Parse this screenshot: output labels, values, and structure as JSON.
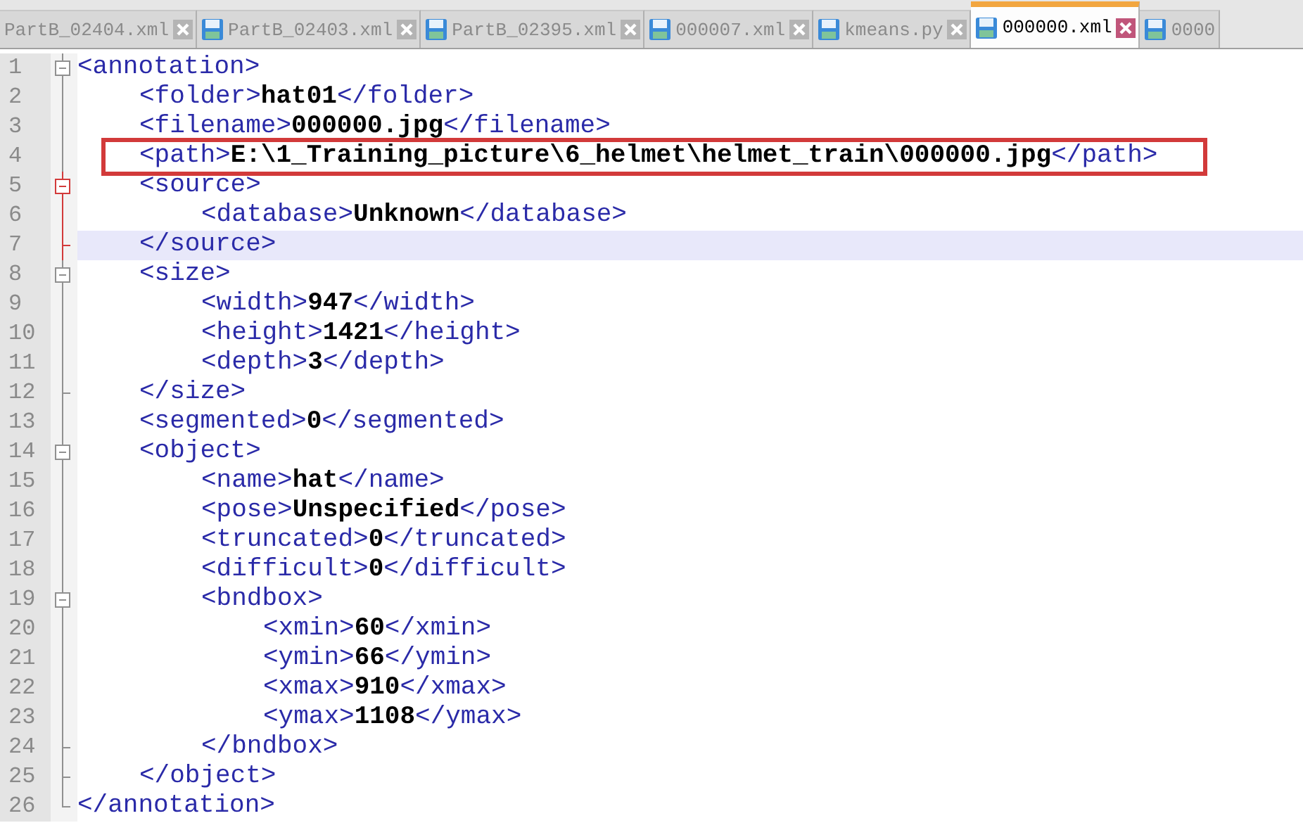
{
  "tabs": [
    {
      "label": "PartB_02404.xml",
      "icon": false,
      "closable": true,
      "selected": false
    },
    {
      "label": "PartB_02403.xml",
      "icon": true,
      "closable": true,
      "selected": false
    },
    {
      "label": "PartB_02395.xml",
      "icon": true,
      "closable": true,
      "selected": false
    },
    {
      "label": "000007.xml",
      "icon": true,
      "closable": true,
      "selected": false
    },
    {
      "label": "kmeans.py",
      "icon": true,
      "closable": true,
      "selected": false
    },
    {
      "label": "000000.xml",
      "icon": true,
      "closable": true,
      "selected": true
    },
    {
      "label": "0000",
      "icon": true,
      "closable": false,
      "selected": false
    }
  ],
  "document": [
    {
      "number": "1",
      "open": "<annotation>",
      "fold_highlighted": false,
      "current": false,
      "boxed": false,
      "children": [
        {
          "number": "2",
          "open": "<folder>",
          "value": "hat01",
          "close": "</folder>",
          "fold_highlighted": false,
          "current": false,
          "boxed": false
        },
        {
          "number": "3",
          "open": "<filename>",
          "value": "000000.jpg",
          "close": "</filename>",
          "fold_highlighted": false,
          "current": false,
          "boxed": false
        },
        {
          "number": "4",
          "open": "<path>",
          "value": "E:\\1_Training_picture\\6_helmet\\helmet_train\\000000.jpg",
          "close": "</path>",
          "fold_highlighted": false,
          "current": false,
          "boxed": true
        },
        {
          "number": "5",
          "open": "<source>",
          "fold_highlighted": true,
          "current": false,
          "boxed": false,
          "children": [
            {
              "number": "6",
              "open": "<database>",
              "value": "Unknown",
              "close": "</database>",
              "fold_highlighted": true,
              "current": false,
              "boxed": false
            }
          ],
          "end": {
            "number": "7",
            "text": "</source>",
            "fold_highlighted": true,
            "current": true
          }
        },
        {
          "number": "8",
          "open": "<size>",
          "fold_highlighted": false,
          "current": false,
          "boxed": false,
          "children": [
            {
              "number": "9",
              "open": "<width>",
              "value": "947",
              "close": "</width>",
              "fold_highlighted": false,
              "current": false,
              "boxed": false
            },
            {
              "number": "10",
              "open": "<height>",
              "value": "1421",
              "close": "</height>",
              "fold_highlighted": false,
              "current": false,
              "boxed": false
            },
            {
              "number": "11",
              "open": "<depth>",
              "value": "3",
              "close": "</depth>",
              "fold_highlighted": false,
              "current": false,
              "boxed": false
            }
          ],
          "end": {
            "number": "12",
            "text": "</size>",
            "fold_highlighted": false,
            "current": false
          }
        },
        {
          "number": "13",
          "open": "<segmented>",
          "value": "0",
          "close": "</segmented>",
          "fold_highlighted": false,
          "current": false,
          "boxed": false
        },
        {
          "number": "14",
          "open": "<object>",
          "fold_highlighted": false,
          "current": false,
          "boxed": false,
          "children": [
            {
              "number": "15",
              "open": "<name>",
              "value": "hat",
              "close": "</name>",
              "fold_highlighted": false,
              "current": false,
              "boxed": false
            },
            {
              "number": "16",
              "open": "<pose>",
              "value": "Unspecified",
              "close": "</pose>",
              "fold_highlighted": false,
              "current": false,
              "boxed": false
            },
            {
              "number": "17",
              "open": "<truncated>",
              "value": "0",
              "close": "</truncated>",
              "fold_highlighted": false,
              "current": false,
              "boxed": false
            },
            {
              "number": "18",
              "open": "<difficult>",
              "value": "0",
              "close": "</difficult>",
              "fold_highlighted": false,
              "current": false,
              "boxed": false
            },
            {
              "number": "19",
              "open": "<bndbox>",
              "fold_highlighted": false,
              "current": false,
              "boxed": false,
              "children": [
                {
                  "number": "20",
                  "open": "<xmin>",
                  "value": "60",
                  "close": "</xmin>",
                  "fold_highlighted": false,
                  "current": false,
                  "boxed": false
                },
                {
                  "number": "21",
                  "open": "<ymin>",
                  "value": "66",
                  "close": "</ymin>",
                  "fold_highlighted": false,
                  "current": false,
                  "boxed": false
                },
                {
                  "number": "22",
                  "open": "<xmax>",
                  "value": "910",
                  "close": "</xmax>",
                  "fold_highlighted": false,
                  "current": false,
                  "boxed": false
                },
                {
                  "number": "23",
                  "open": "<ymax>",
                  "value": "1108",
                  "close": "</ymax>",
                  "fold_highlighted": false,
                  "current": false,
                  "boxed": false
                }
              ],
              "end": {
                "number": "24",
                "text": "</bndbox>",
                "fold_highlighted": false,
                "current": false
              }
            }
          ],
          "end": {
            "number": "25",
            "text": "</object>",
            "fold_highlighted": false,
            "current": false
          }
        }
      ],
      "end": {
        "number": "26",
        "text": "</annotation>",
        "fold_highlighted": false,
        "current": false
      }
    }
  ]
}
